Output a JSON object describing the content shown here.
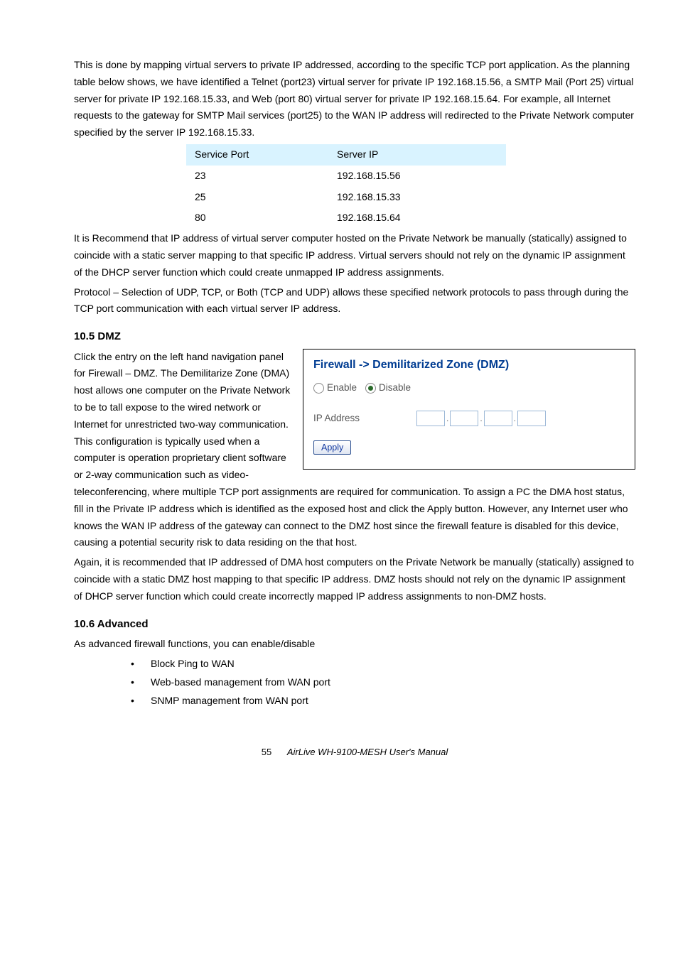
{
  "paragraphs": {
    "intro": "This is done by mapping virtual servers to private IP addressed, according to the specific TCP port application. As the planning table below shows, we have identified a Telnet (port23) virtual server for private IP 192.168.15.56, a SMTP Mail (Port 25) virtual server for private IP 192.168.15.33, and Web (port 80) virtual server for private IP 192.168.15.64. For example, all Internet requests to the gateway for SMTP Mail services (port25) to the WAN IP address will redirected to the Private Network computer specified by the server IP 192.168.15.33.",
    "after_table": "It is Recommend that IP address of virtual server computer hosted on the Private Network be manually (statically) assigned to coincide with a static server mapping to that specific IP address. Virtual servers should not rely on the dynamic IP assignment of the DHCP server function which could create unmapped IP address assignments.",
    "protocol": "Protocol – Selection of UDP, TCP, or Both (TCP and UDP) allows these specified network protocols to pass through during the TCP port communication with each virtual server IP address.",
    "dmz_intro": "Click the entry on the left hand navigation panel for Firewall – DMZ. The Demilitarize Zone (DMA) host allows one computer on the Private Network to be to tall expose to the wired network or Internet for unrestricted two-way communication. This configuration is typically used when a computer is operation proprietary client software or 2-way communication such as video-teleconferencing, where multiple TCP port assignments are required for communication. To assign a PC the DMA host status, fill in the Private IP address which is identified as the exposed host and click the Apply button. However, any Internet user who knows the WAN IP address of the gateway can connect to the DMZ host since the firewall feature is disabled for this device, causing a potential security risk to data residing on the that host.",
    "dmz_again": "Again, it is recommended that IP addressed of DMA host computers on the Private Network be manually (statically) assigned to coincide with a static DMZ host mapping to that specific IP address. DMZ hosts should not rely on the dynamic IP assignment of DHCP server function which could create incorrectly mapped IP address assignments to non-DMZ hosts.",
    "adv_intro": "As advanced firewall functions, you can enable/disable"
  },
  "table": {
    "header": {
      "port": "Service Port",
      "ip": "Server IP"
    },
    "rows": [
      {
        "port": "23",
        "ip": "192.168.15.56"
      },
      {
        "port": "25",
        "ip": "192.168.15.33"
      },
      {
        "port": "80",
        "ip": "192.168.15.64"
      }
    ]
  },
  "headings": {
    "dmz": "10.5 DMZ",
    "adv": "10.6 Advanced"
  },
  "ui": {
    "title": "Firewall -> Demilitarized Zone (DMZ)",
    "enable_label": "Enable",
    "disable_label": "Disable",
    "ip_label": "IP Address",
    "apply_label": "Apply"
  },
  "bullets": [
    "Block Ping to WAN",
    "Web-based management from WAN port",
    "SNMP management from WAN port"
  ],
  "footer": {
    "pagenum": "55",
    "manual": "AirLive WH-9100-MESH  User's  Manual"
  }
}
